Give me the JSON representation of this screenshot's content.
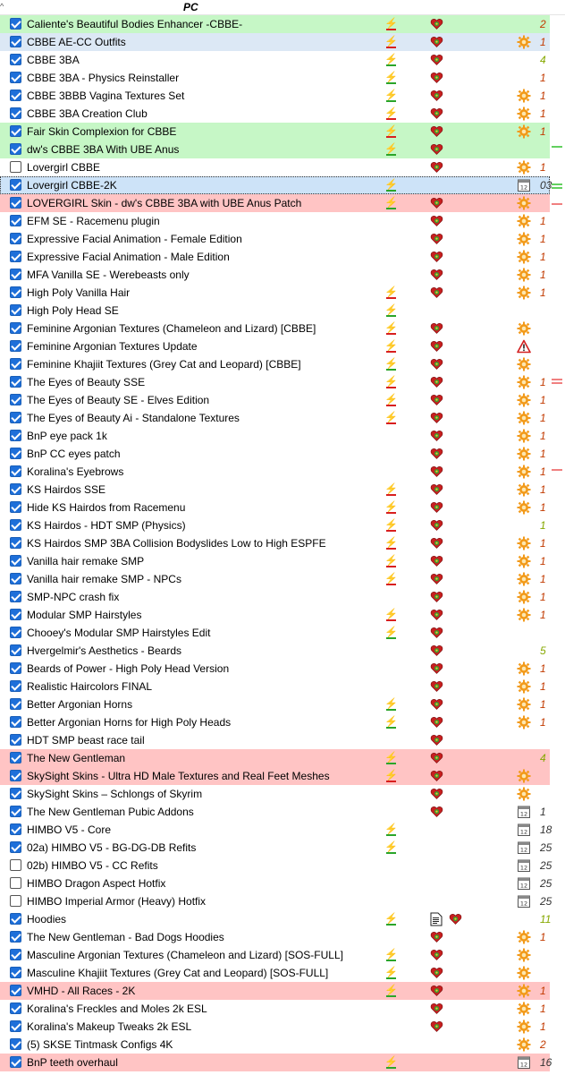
{
  "header": {
    "sort_indicator": "^",
    "column_title": "PC"
  },
  "rows": [
    {
      "name": "Caliente's Beautiful Bodies Enhancer -CBBE-",
      "checked": true,
      "hl": "green",
      "flag": "r",
      "heart": true,
      "right": "",
      "ver": "2"
    },
    {
      "name": "CBBE AE-CC Outfits",
      "checked": true,
      "hl": "blue",
      "flag": "r",
      "heart": true,
      "right": "gear",
      "ver": "1"
    },
    {
      "name": "CBBE 3BA",
      "checked": true,
      "hl": "",
      "flag": "g",
      "heart": true,
      "right": "",
      "ver": "4"
    },
    {
      "name": "CBBE 3BA - Physics Reinstaller",
      "checked": true,
      "hl": "",
      "flag": "g",
      "heart": true,
      "right": "",
      "ver": "1"
    },
    {
      "name": "CBBE 3BBB Vagina Textures Set",
      "checked": true,
      "hl": "",
      "flag": "g",
      "heart": true,
      "right": "gear",
      "ver": "1"
    },
    {
      "name": "CBBE 3BA Creation Club",
      "checked": true,
      "hl": "",
      "flag": "r",
      "heart": true,
      "right": "gear",
      "ver": "1"
    },
    {
      "name": "Fair Skin Complexion for CBBE",
      "checked": true,
      "hl": "green",
      "flag": "r",
      "heart": true,
      "right": "gear",
      "ver": "1"
    },
    {
      "name": "dw's CBBE 3BA With UBE Anus",
      "checked": true,
      "hl": "green",
      "flag": "g",
      "heart": true,
      "right": "",
      "ver": ""
    },
    {
      "name": "Lovergirl CBBE",
      "checked": false,
      "hl": "",
      "flag": "",
      "heart": true,
      "right": "gear",
      "ver": "1"
    },
    {
      "name": "Lovergirl CBBE-2K",
      "checked": true,
      "hl": "selected",
      "flag": "g",
      "heart": false,
      "right": "cal",
      "ver": "03"
    },
    {
      "name": "LOVERGIRL Skin - dw's CBBE 3BA with UBE Anus Patch",
      "checked": true,
      "hl": "red",
      "flag": "g",
      "heart": true,
      "right": "gear",
      "ver": ""
    },
    {
      "name": "EFM SE - Racemenu plugin",
      "checked": true,
      "hl": "",
      "flag": "",
      "heart": true,
      "right": "gear",
      "ver": "1"
    },
    {
      "name": "Expressive Facial Animation - Female Edition",
      "checked": true,
      "hl": "",
      "flag": "",
      "heart": true,
      "right": "gear",
      "ver": "1"
    },
    {
      "name": "Expressive Facial Animation - Male Edition",
      "checked": true,
      "hl": "",
      "flag": "",
      "heart": true,
      "right": "gear",
      "ver": "1"
    },
    {
      "name": "MFA Vanilla SE - Werebeasts only",
      "checked": true,
      "hl": "",
      "flag": "",
      "heart": true,
      "right": "gear",
      "ver": "1"
    },
    {
      "name": "High Poly Vanilla Hair",
      "checked": true,
      "hl": "",
      "flag": "r",
      "heart": true,
      "right": "gear",
      "ver": "1"
    },
    {
      "name": "High Poly Head SE",
      "checked": true,
      "hl": "",
      "flag": "g",
      "heart": false,
      "right": "",
      "ver": ""
    },
    {
      "name": "Feminine Argonian Textures (Chameleon and Lizard) [CBBE]",
      "checked": true,
      "hl": "",
      "flag": "r",
      "heart": true,
      "right": "gear",
      "ver": ""
    },
    {
      "name": "Feminine Argonian Textures Update",
      "checked": true,
      "hl": "",
      "flag": "r",
      "heart": true,
      "right": "warn",
      "ver": ""
    },
    {
      "name": "Feminine Khajiit Textures (Grey Cat and Leopard) [CBBE]",
      "checked": true,
      "hl": "",
      "flag": "g",
      "heart": true,
      "right": "gear",
      "ver": ""
    },
    {
      "name": "The Eyes of Beauty SSE",
      "checked": true,
      "hl": "",
      "flag": "r",
      "heart": true,
      "right": "gear",
      "ver": "1"
    },
    {
      "name": "The Eyes of Beauty SE - Elves Edition",
      "checked": true,
      "hl": "",
      "flag": "r",
      "heart": true,
      "right": "gear",
      "ver": "1"
    },
    {
      "name": "The Eyes of Beauty Ai - Standalone Textures",
      "checked": true,
      "hl": "",
      "flag": "r",
      "heart": true,
      "right": "gear",
      "ver": "1"
    },
    {
      "name": "BnP eye pack 1k",
      "checked": true,
      "hl": "",
      "flag": "",
      "heart": true,
      "right": "gear",
      "ver": "1"
    },
    {
      "name": "BnP CC eyes patch",
      "checked": true,
      "hl": "",
      "flag": "",
      "heart": true,
      "right": "gear",
      "ver": "1"
    },
    {
      "name": "Koralina's Eyebrows",
      "checked": true,
      "hl": "",
      "flag": "",
      "heart": true,
      "right": "gear",
      "ver": "1"
    },
    {
      "name": "KS Hairdos SSE",
      "checked": true,
      "hl": "",
      "flag": "r",
      "heart": true,
      "right": "gear",
      "ver": "1"
    },
    {
      "name": "Hide KS Hairdos from Racemenu",
      "checked": true,
      "hl": "",
      "flag": "r",
      "heart": true,
      "right": "gear",
      "ver": "1"
    },
    {
      "name": "KS Hairdos - HDT SMP (Physics)",
      "checked": true,
      "hl": "",
      "flag": "r",
      "heart": true,
      "right": "",
      "ver": "1"
    },
    {
      "name": "KS Hairdos SMP 3BA Collision Bodyslides Low to High ESPFE",
      "checked": true,
      "hl": "",
      "flag": "r",
      "heart": true,
      "right": "gear",
      "ver": "1"
    },
    {
      "name": "Vanilla hair remake SMP",
      "checked": true,
      "hl": "",
      "flag": "r",
      "heart": true,
      "right": "gear",
      "ver": "1"
    },
    {
      "name": "Vanilla hair remake SMP - NPCs",
      "checked": true,
      "hl": "",
      "flag": "r",
      "heart": true,
      "right": "gear",
      "ver": "1"
    },
    {
      "name": "SMP-NPC crash fix",
      "checked": true,
      "hl": "",
      "flag": "",
      "heart": true,
      "right": "gear",
      "ver": "1"
    },
    {
      "name": "Modular SMP Hairstyles",
      "checked": true,
      "hl": "",
      "flag": "r",
      "heart": true,
      "right": "gear",
      "ver": "1"
    },
    {
      "name": "Chooey's Modular SMP Hairstyles Edit",
      "checked": true,
      "hl": "",
      "flag": "g",
      "heart": true,
      "right": "",
      "ver": ""
    },
    {
      "name": "Hvergelmir's Aesthetics - Beards",
      "checked": true,
      "hl": "",
      "flag": "",
      "heart": true,
      "right": "",
      "ver": "5"
    },
    {
      "name": "Beards of Power - High Poly Head Version",
      "checked": true,
      "hl": "",
      "flag": "",
      "heart": true,
      "right": "gear",
      "ver": "1"
    },
    {
      "name": "Realistic Haircolors FINAL",
      "checked": true,
      "hl": "",
      "flag": "",
      "heart": true,
      "right": "gear",
      "ver": "1"
    },
    {
      "name": "Better Argonian Horns",
      "checked": true,
      "hl": "",
      "flag": "g",
      "heart": true,
      "right": "gear",
      "ver": "1"
    },
    {
      "name": "Better Argonian Horns for High Poly Heads",
      "checked": true,
      "hl": "",
      "flag": "g",
      "heart": true,
      "right": "gear",
      "ver": "1"
    },
    {
      "name": "HDT SMP beast race tail",
      "checked": true,
      "hl": "",
      "flag": "",
      "heart": true,
      "right": "",
      "ver": ""
    },
    {
      "name": "The New Gentleman",
      "checked": true,
      "hl": "red",
      "flag": "g",
      "heart": true,
      "right": "",
      "ver": "4"
    },
    {
      "name": "SkySight Skins - Ultra HD Male Textures and Real Feet Meshes",
      "checked": true,
      "hl": "red",
      "flag": "r",
      "heart": true,
      "right": "gear",
      "ver": ""
    },
    {
      "name": "SkySight Skins – Schlongs of Skyrim",
      "checked": true,
      "hl": "",
      "flag": "",
      "heart": true,
      "right": "gear",
      "ver": ""
    },
    {
      "name": "The New Gentleman Pubic Addons",
      "checked": true,
      "hl": "",
      "flag": "",
      "heart": true,
      "right": "cal",
      "ver": "1"
    },
    {
      "name": "HIMBO V5 - Core",
      "checked": true,
      "hl": "",
      "flag": "g",
      "heart": false,
      "right": "cal",
      "ver": "18"
    },
    {
      "name": "02a) HIMBO V5 - BG-DG-DB Refits",
      "checked": true,
      "hl": "",
      "flag": "g",
      "heart": false,
      "right": "cal",
      "ver": "25"
    },
    {
      "name": "02b) HIMBO V5 - CC Refits",
      "checked": false,
      "hl": "",
      "flag": "",
      "heart": false,
      "right": "cal",
      "ver": "25"
    },
    {
      "name": "HIMBO Dragon Aspect Hotfix",
      "checked": false,
      "hl": "",
      "flag": "",
      "heart": false,
      "right": "cal",
      "ver": "25"
    },
    {
      "name": "HIMBO Imperial Armor (Heavy) Hotfix",
      "checked": false,
      "hl": "",
      "flag": "",
      "heart": false,
      "right": "cal",
      "ver": "25"
    },
    {
      "name": "Hoodies",
      "checked": true,
      "hl": "",
      "flag": "g",
      "heart": false,
      "doc": true,
      "right": "",
      "ver": "11"
    },
    {
      "name": "The New Gentleman - Bad Dogs Hoodies",
      "checked": true,
      "hl": "",
      "flag": "",
      "heart": true,
      "right": "gear",
      "ver": "1"
    },
    {
      "name": "Masculine Argonian Textures (Chameleon and Lizard) [SOS-FULL]",
      "checked": true,
      "hl": "",
      "flag": "g",
      "heart": true,
      "right": "gear",
      "ver": ""
    },
    {
      "name": "Masculine Khajiit Textures (Grey Cat and Leopard) [SOS-FULL]",
      "checked": true,
      "hl": "",
      "flag": "g",
      "heart": true,
      "right": "gear",
      "ver": ""
    },
    {
      "name": "VMHD - All Races - 2K",
      "checked": true,
      "hl": "red",
      "flag": "g",
      "heart": true,
      "right": "gear",
      "ver": "1"
    },
    {
      "name": "Koralina's Freckles and Moles 2k ESL",
      "checked": true,
      "hl": "",
      "flag": "",
      "heart": true,
      "right": "gear",
      "ver": "1"
    },
    {
      "name": "Koralina's Makeup Tweaks 2k ESL",
      "checked": true,
      "hl": "",
      "flag": "",
      "heart": true,
      "right": "gear",
      "ver": "1"
    },
    {
      "name": "(5) SKSE Tintmask Configs 4K",
      "checked": true,
      "hl": "",
      "flag": "",
      "heart": false,
      "right": "gear",
      "ver": "2"
    },
    {
      "name": "BnP teeth overhaul",
      "checked": true,
      "hl": "red",
      "flag": "g",
      "heart": false,
      "right": "cal",
      "ver": "16"
    }
  ],
  "colors": {
    "checkbox": "#1e6fd9",
    "green_row": "#c6f7c6",
    "red_row": "#ffc4c4",
    "blue_row": "#dce8f5",
    "version": "#c23a00"
  }
}
